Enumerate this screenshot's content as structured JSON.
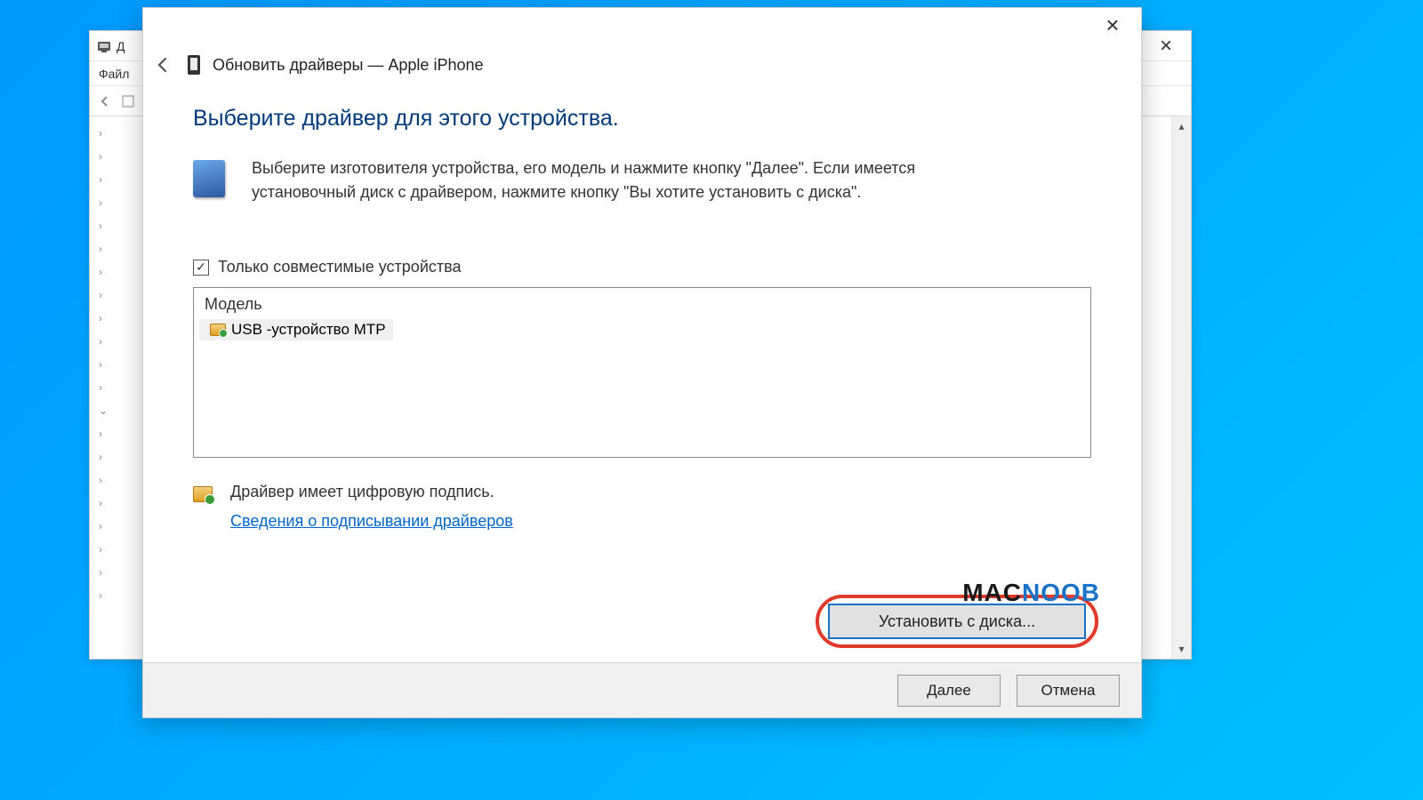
{
  "back_window": {
    "title_fragment": "Д",
    "menu_file": "Файл",
    "close_label": "×"
  },
  "dialog": {
    "close_label": "×",
    "title": "Обновить драйверы — Apple iPhone",
    "heading": "Выберите драйвер для этого устройства.",
    "instruction": "Выберите изготовителя устройства, его модель и нажмите кнопку \"Далее\". Если имеется установочный диск с драйвером, нажмите кнопку \"Вы хотите установить с диска\".",
    "checkbox_label": "Только совместимые устройства",
    "checkbox_checked": true,
    "listbox": {
      "header": "Модель",
      "items": [
        "USB -устройство MTP"
      ]
    },
    "signature_text": "Драйвер имеет цифровую подпись.",
    "signature_link": "Сведения о подписывании драйверов",
    "install_from_disk": "Установить с диска...",
    "next_button": "Далее",
    "cancel_button": "Отмена"
  },
  "watermark": {
    "part1": "MAC",
    "part2": "NOOB"
  }
}
